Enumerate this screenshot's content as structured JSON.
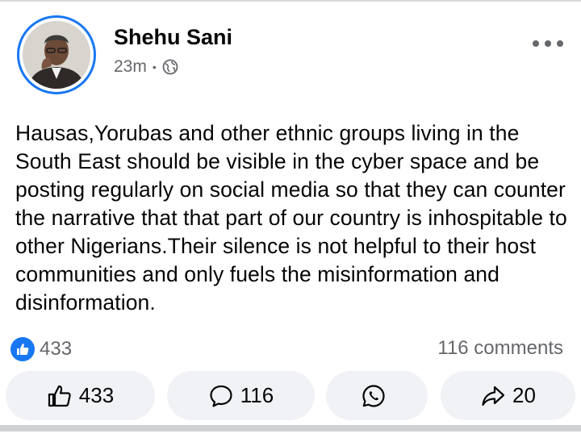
{
  "post": {
    "author": "Shehu Sani",
    "time": "23m",
    "separator": "•",
    "audience_icon": "globe-icon",
    "text": "Hausas,Yorubas and other ethnic groups living in the South East should be visible in the cyber space and be posting regularly on social media so that they can counter the narrative that that part of our country is inhospitable to other Nigerians.Their silence is not helpful to their host communities and only fuels the misinformation and disinformation."
  },
  "stats": {
    "reactions": "433",
    "comments": "116 comments"
  },
  "actions": {
    "like": {
      "label": "433",
      "icon": "thumbs-up-icon"
    },
    "comment": {
      "label": "116",
      "icon": "comment-icon"
    },
    "whatsapp": {
      "label": "",
      "icon": "whatsapp-icon"
    },
    "share": {
      "label": "20",
      "icon": "share-icon"
    }
  },
  "colors": {
    "accent": "#1877f2",
    "muted": "#65676b",
    "button_bg": "#f0f2f5"
  }
}
